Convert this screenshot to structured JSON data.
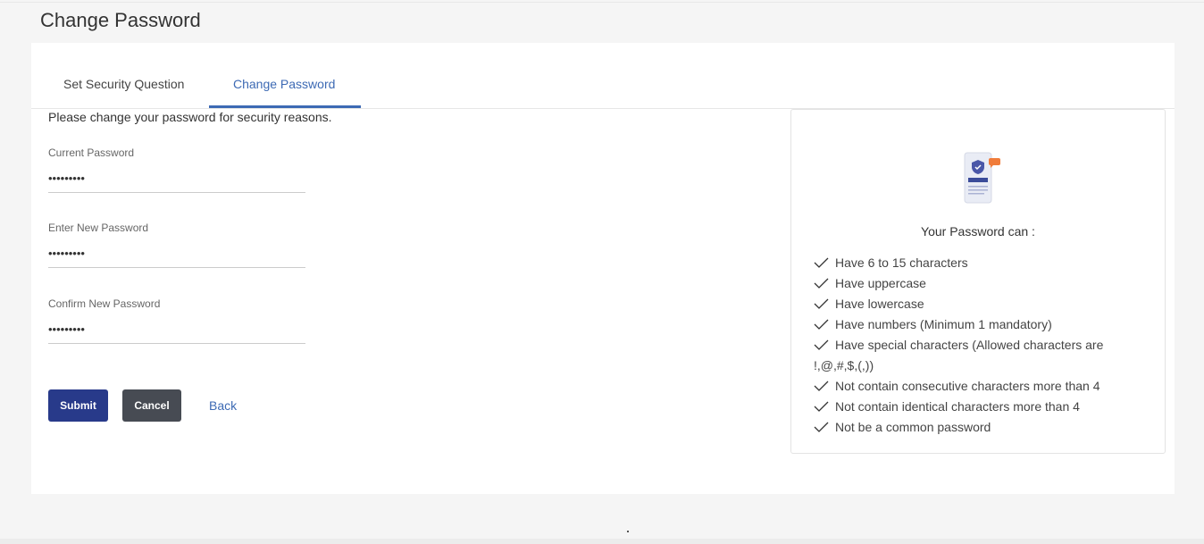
{
  "page": {
    "title": "Change Password"
  },
  "tabs": [
    {
      "label": "Set Security Question",
      "active": false
    },
    {
      "label": "Change Password",
      "active": true
    }
  ],
  "form": {
    "intro": "Please change your password for security reasons.",
    "current_password": {
      "label": "Current Password",
      "value": "•••••••••"
    },
    "new_password": {
      "label": "Enter New Password",
      "value": "•••••••••"
    },
    "confirm_password": {
      "label": "Confirm New Password",
      "value": "•••••••••"
    }
  },
  "actions": {
    "submit_label": "Submit",
    "cancel_label": "Cancel",
    "back_label": "Back"
  },
  "rules": {
    "heading": "Your Password can :",
    "items": [
      "Have 6 to 15 characters",
      "Have uppercase",
      "Have lowercase",
      "Have numbers (Minimum 1 mandatory)",
      "Have special characters (Allowed characters are !,@,#,$,(,))",
      "Not contain consecutive characters more than 4",
      "Not contain identical characters more than 4",
      "Not be a common password"
    ]
  },
  "colors": {
    "accent": "#3d6ab4",
    "submit": "#283a8a",
    "cancel": "#474b53",
    "illustration_badge": "#f07c3a"
  }
}
